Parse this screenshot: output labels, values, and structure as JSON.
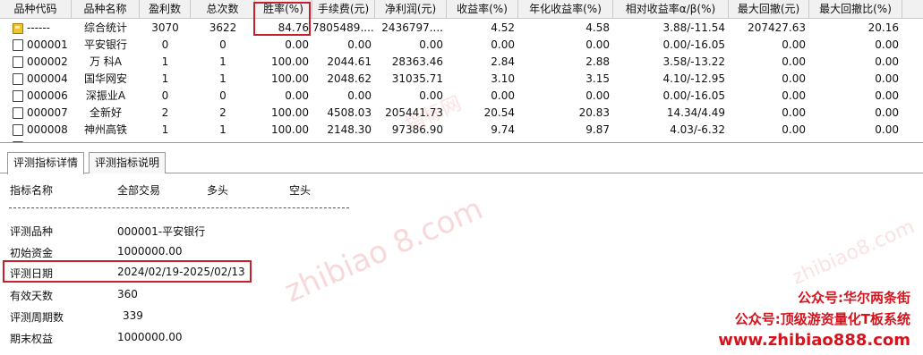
{
  "table": {
    "headers": [
      "品种代码",
      "品种名称",
      "盈利数",
      "总次数",
      "胜率(%)",
      "手续费(元)",
      "净利润(元)",
      "收益率(%)",
      "年化收益率(%)",
      "相对收益率α/β(%)",
      "最大回撤(元)",
      "最大回撤比(%)"
    ],
    "rows": [
      {
        "code": "------",
        "icon": "folder-icon",
        "name": "综合统计",
        "wins": "3070",
        "total": "3622",
        "win_rate": "84.76",
        "fee": "7805489....",
        "net": "2436797....",
        "ret": "4.52",
        "annual": "4.58",
        "rel": "3.88/-11.54",
        "mdd": "207427.63",
        "mdd_ratio": "20.16"
      },
      {
        "code": "000001",
        "icon": "document-icon",
        "name": "平安银行",
        "wins": "0",
        "total": "0",
        "win_rate": "0.00",
        "fee": "0.00",
        "net": "0.00",
        "ret": "0.00",
        "annual": "0.00",
        "rel": "0.00/-16.05",
        "mdd": "0.00",
        "mdd_ratio": "0.00"
      },
      {
        "code": "000002",
        "icon": "document-icon",
        "name": "万 科A",
        "wins": "1",
        "total": "1",
        "win_rate": "100.00",
        "fee": "2044.61",
        "net": "28363.46",
        "ret": "2.84",
        "annual": "2.88",
        "rel": "3.58/-13.22",
        "mdd": "0.00",
        "mdd_ratio": "0.00"
      },
      {
        "code": "000004",
        "icon": "document-icon",
        "name": "国华网安",
        "wins": "1",
        "total": "1",
        "win_rate": "100.00",
        "fee": "2048.62",
        "net": "31035.71",
        "ret": "3.10",
        "annual": "3.15",
        "rel": "4.10/-12.95",
        "mdd": "0.00",
        "mdd_ratio": "0.00"
      },
      {
        "code": "000006",
        "icon": "document-icon",
        "name": "深振业A",
        "wins": "0",
        "total": "0",
        "win_rate": "0.00",
        "fee": "0.00",
        "net": "0.00",
        "ret": "0.00",
        "annual": "0.00",
        "rel": "0.00/-16.05",
        "mdd": "0.00",
        "mdd_ratio": "0.00"
      },
      {
        "code": "000007",
        "icon": "document-icon",
        "name": "全新好",
        "wins": "2",
        "total": "2",
        "win_rate": "100.00",
        "fee": "4508.03",
        "net": "205441.73",
        "ret": "20.54",
        "annual": "20.83",
        "rel": "14.34/4.49",
        "mdd": "0.00",
        "mdd_ratio": "0.00"
      },
      {
        "code": "000008",
        "icon": "document-icon",
        "name": "神州高铁",
        "wins": "1",
        "total": "1",
        "win_rate": "100.00",
        "fee": "2148.30",
        "net": "97386.90",
        "ret": "9.74",
        "annual": "9.87",
        "rel": "4.03/-6.32",
        "mdd": "0.00",
        "mdd_ratio": "0.00"
      }
    ]
  },
  "tabs": [
    "评测指标详情",
    "评测指标说明"
  ],
  "detail": {
    "col_headers": [
      "指标名称",
      "全部交易",
      "多头",
      "空头"
    ],
    "items": [
      {
        "label": "评测品种",
        "value": "000001-平安银行"
      },
      {
        "label": "初始资金",
        "value": "1000000.00"
      },
      {
        "label": "评测日期",
        "value": "2024/02/19-2025/02/13"
      },
      {
        "label": "有效天数",
        "value": "360"
      },
      {
        "label": "评测周期数",
        "value": "339"
      },
      {
        "label": "期末权益",
        "value": "1000000.00"
      }
    ]
  },
  "watermarks": {
    "center": "zhibiao  8.com",
    "grid": "指标网",
    "right": "zhibiao8.com"
  },
  "promo": {
    "line1": "公众号:华尔两条街",
    "line2": "公众号:顶级游资量化T板系统",
    "line3": "www.zhibiao888.com"
  },
  "colors": {
    "highlight": "#c8202a",
    "promo": "#d6141d"
  }
}
